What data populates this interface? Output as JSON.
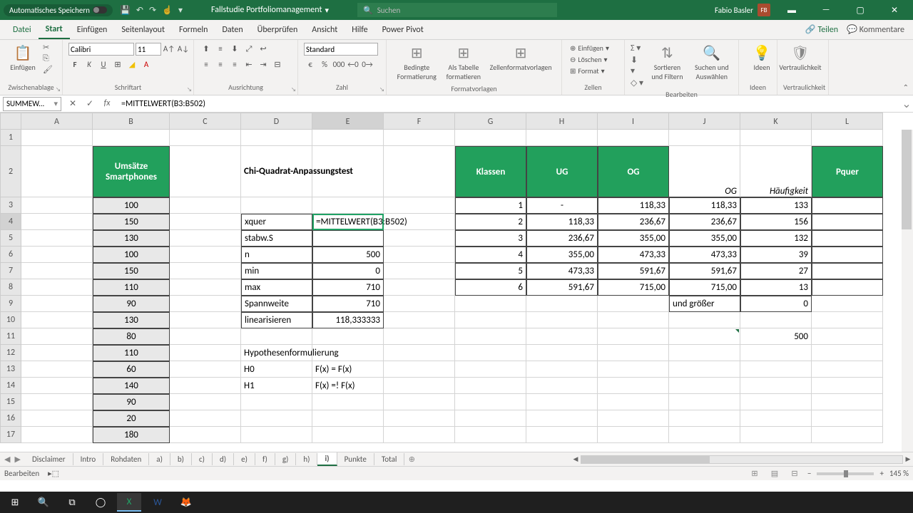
{
  "title": {
    "autosave": "Automatisches Speichern",
    "docname": "Fallstudie Portfoliomanagement",
    "search_placeholder": "Suchen",
    "user": "Fabio Basler",
    "initials": "FB"
  },
  "tabs": {
    "file": "Datei",
    "home": "Start",
    "insert": "Einfügen",
    "page": "Seitenlayout",
    "formulas": "Formeln",
    "data": "Daten",
    "review": "Überprüfen",
    "view": "Ansicht",
    "help": "Hilfe",
    "powerpivot": "Power Pivot",
    "share": "Teilen",
    "comments": "Kommentare"
  },
  "ribbon": {
    "clipboard": {
      "paste": "Einfügen",
      "label": "Zwischenablage"
    },
    "font": {
      "name": "Calibri",
      "size": "11",
      "label": "Schriftart"
    },
    "align": {
      "label": "Ausrichtung"
    },
    "number": {
      "fmt": "Standard",
      "label": "Zahl"
    },
    "styles": {
      "cond": "Bedingte Formatierung",
      "table": "Als Tabelle formatieren",
      "cellstyles": "Zellenformatvorlagen",
      "label": "Formatvorlagen"
    },
    "cells": {
      "insert": "Einfügen",
      "delete": "Löschen",
      "format": "Format",
      "label": "Zellen"
    },
    "editing": {
      "sortfilter": "Sortieren und Filtern",
      "findselect": "Suchen und Auswählen",
      "label": "Bearbeiten"
    },
    "ideas": {
      "ideas": "Ideen",
      "label": "Ideen"
    },
    "sensitivity": {
      "sens": "Vertraulichkeit",
      "label": "Vertraulichkeit"
    }
  },
  "formulabar": {
    "namebox": "SUMMEW...",
    "formula": "=MITTELWERT(B3:B502)"
  },
  "columns": [
    "A",
    "B",
    "C",
    "D",
    "E",
    "F",
    "G",
    "H",
    "I",
    "J",
    "K",
    "L"
  ],
  "rowheaders": [
    "1",
    "2",
    "3",
    "4",
    "5",
    "6",
    "7",
    "8",
    "9",
    "10",
    "11",
    "12",
    "13",
    "14",
    "15",
    "16",
    "17"
  ],
  "data": {
    "b2": "Umsätze Smartphones",
    "d2": "Chi-Quadrat-Anpassungstest",
    "g2": "Klassen",
    "h2": "UG",
    "i2": "OG",
    "j2": "OG",
    "k2": "Häufigkeit",
    "l2": "Pquer",
    "b3": "100",
    "b4": "150",
    "b5": "130",
    "b6": "100",
    "b7": "150",
    "b8": "110",
    "b9": "90",
    "b10": "130",
    "b11": "80",
    "b12": "110",
    "b13": "60",
    "b14": "140",
    "b15": "90",
    "b16": "20",
    "b17": "180",
    "d4": "xquer",
    "e4": "=MITTELWERT(B3:B502)",
    "d5": "stabw.S",
    "d6": "n",
    "e6": "500",
    "d7": "min",
    "e7": "0",
    "d8": "max",
    "e8": "710",
    "d9": "Spannweite",
    "e9": "710",
    "d10": "linearisieren",
    "e10": "118,333333",
    "d12": "Hypothesenformulierung",
    "d13": "H0",
    "e13": "F(x) = F(x)",
    "d14": "H1",
    "e14": "F(x) =! F(x)",
    "g3": "1",
    "g4": "2",
    "g5": "3",
    "g6": "4",
    "g7": "5",
    "g8": "6",
    "h3": "-",
    "h4": "118,33",
    "h5": "236,67",
    "h6": "355,00",
    "h7": "473,33",
    "h8": "591,67",
    "i3": "118,33",
    "i4": "236,67",
    "i5": "355,00",
    "i6": "473,33",
    "i7": "591,67",
    "i8": "715,00",
    "j3": "118,33",
    "j4": "236,67",
    "j5": "355,00",
    "j6": "473,33",
    "j7": "591,67",
    "j8": "715,00",
    "k3": "133",
    "k4": "156",
    "k5": "132",
    "k6": "39",
    "k7": "27",
    "k8": "13",
    "j9": "und größer",
    "k9": "0",
    "k11": "500"
  },
  "sheets": [
    "Disclaimer",
    "Intro",
    "Rohdaten",
    "a)",
    "b)",
    "c)",
    "d)",
    "e)",
    "f)",
    "g)",
    "h)",
    "i)",
    "Punkte",
    "Total"
  ],
  "active_sheet": "i)",
  "status": {
    "mode": "Bearbeiten",
    "zoom": "145 %"
  }
}
